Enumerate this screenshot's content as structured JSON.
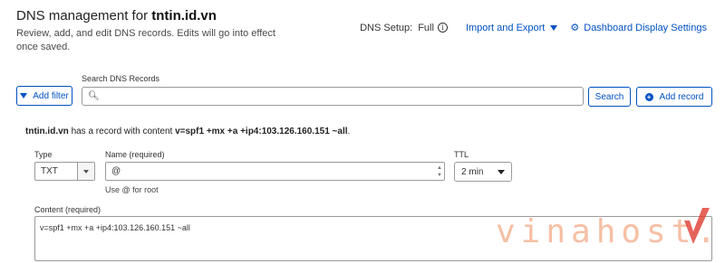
{
  "header": {
    "title_prefix": "DNS management for",
    "domain": "tntin.id.vn",
    "subtitle": "Review, add, and edit DNS records. Edits will go into effect once saved.",
    "dns_setup_label": "DNS Setup:",
    "dns_setup_value": "Full",
    "import_export_label": "Import and Export",
    "dashboard_settings_label": "Dashboard Display Settings"
  },
  "toolbar": {
    "add_filter_label": "Add filter",
    "search_label": "Search DNS Records",
    "search_value": "",
    "search_button_label": "Search",
    "add_record_label": "Add record"
  },
  "record": {
    "domain": "tntin.id.vn",
    "text_middle": "has a record with content",
    "content_value": "v=spf1 +mx +a +ip4:103.126.160.151 ~all",
    "end": "."
  },
  "form": {
    "type_label": "Type",
    "type_value": "TXT",
    "name_label": "Name (required)",
    "name_value": "@",
    "name_hint": "Use @ for root",
    "ttl_label": "TTL",
    "ttl_value": "2 min",
    "content_label": "Content (required)",
    "content_value": "v=spf1 +mx +a +ip4:103.126.160.151 ~all"
  },
  "watermark": {
    "text": "vinahost.vn",
    "color": "#ef8a5a",
    "accent": "#e03c31"
  },
  "colors": {
    "link": "#0051c3",
    "border": "#9a9a9a"
  }
}
